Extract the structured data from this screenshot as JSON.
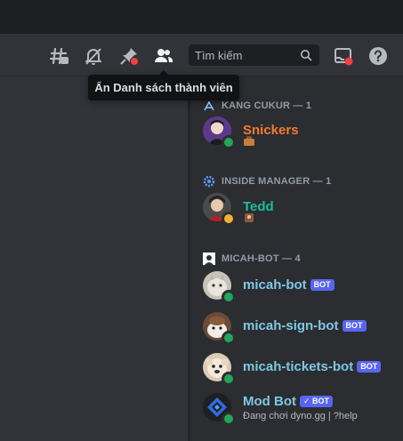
{
  "header": {
    "icons": {
      "threads": "threads-icon",
      "notifications": "bell-muted-icon",
      "pins": "pin-icon",
      "members": "members-icon",
      "inbox": "inbox-icon",
      "help": "help-icon"
    },
    "search": {
      "placeholder": "Tìm kiếm"
    }
  },
  "tooltip": {
    "text": "Ẩn Danh sách thành viên"
  },
  "members": {
    "categories": [
      {
        "label": "KANG CUKUR — 1",
        "icon": "role-icon"
      },
      {
        "label": "INSIDE MANAGER — 1",
        "icon": "gear-icon"
      },
      {
        "label": "MICAH-BOT — 4",
        "icon": "bot-role-icon"
      }
    ],
    "items": [
      {
        "name": "Snickers",
        "color": "#f47b30",
        "subtitle_icon": "briefcase-icon",
        "status": "online"
      },
      {
        "name": "Tedd",
        "color": "#1abc9c",
        "subtitle_icon": "badge-icon",
        "status": "idle"
      },
      {
        "name": "micah-bot",
        "color": "#7ec8e3",
        "badge": "BOT",
        "status": "online"
      },
      {
        "name": "micah-sign-bot",
        "color": "#7ec8e3",
        "badge": "BOT",
        "status": "online"
      },
      {
        "name": "micah-tickets-bot",
        "color": "#7ec8e3",
        "badge": "BOT",
        "status": "online"
      },
      {
        "name": "Mod Bot",
        "color": "#7ec8e3",
        "badge": "✓ BOT",
        "status": "online",
        "activity": "Đang chơi dyno.gg | ?help"
      }
    ]
  },
  "colors": {
    "accent": "#5865f2",
    "online": "#23a55a",
    "idle": "#f0b232",
    "alert": "#f23f43"
  }
}
